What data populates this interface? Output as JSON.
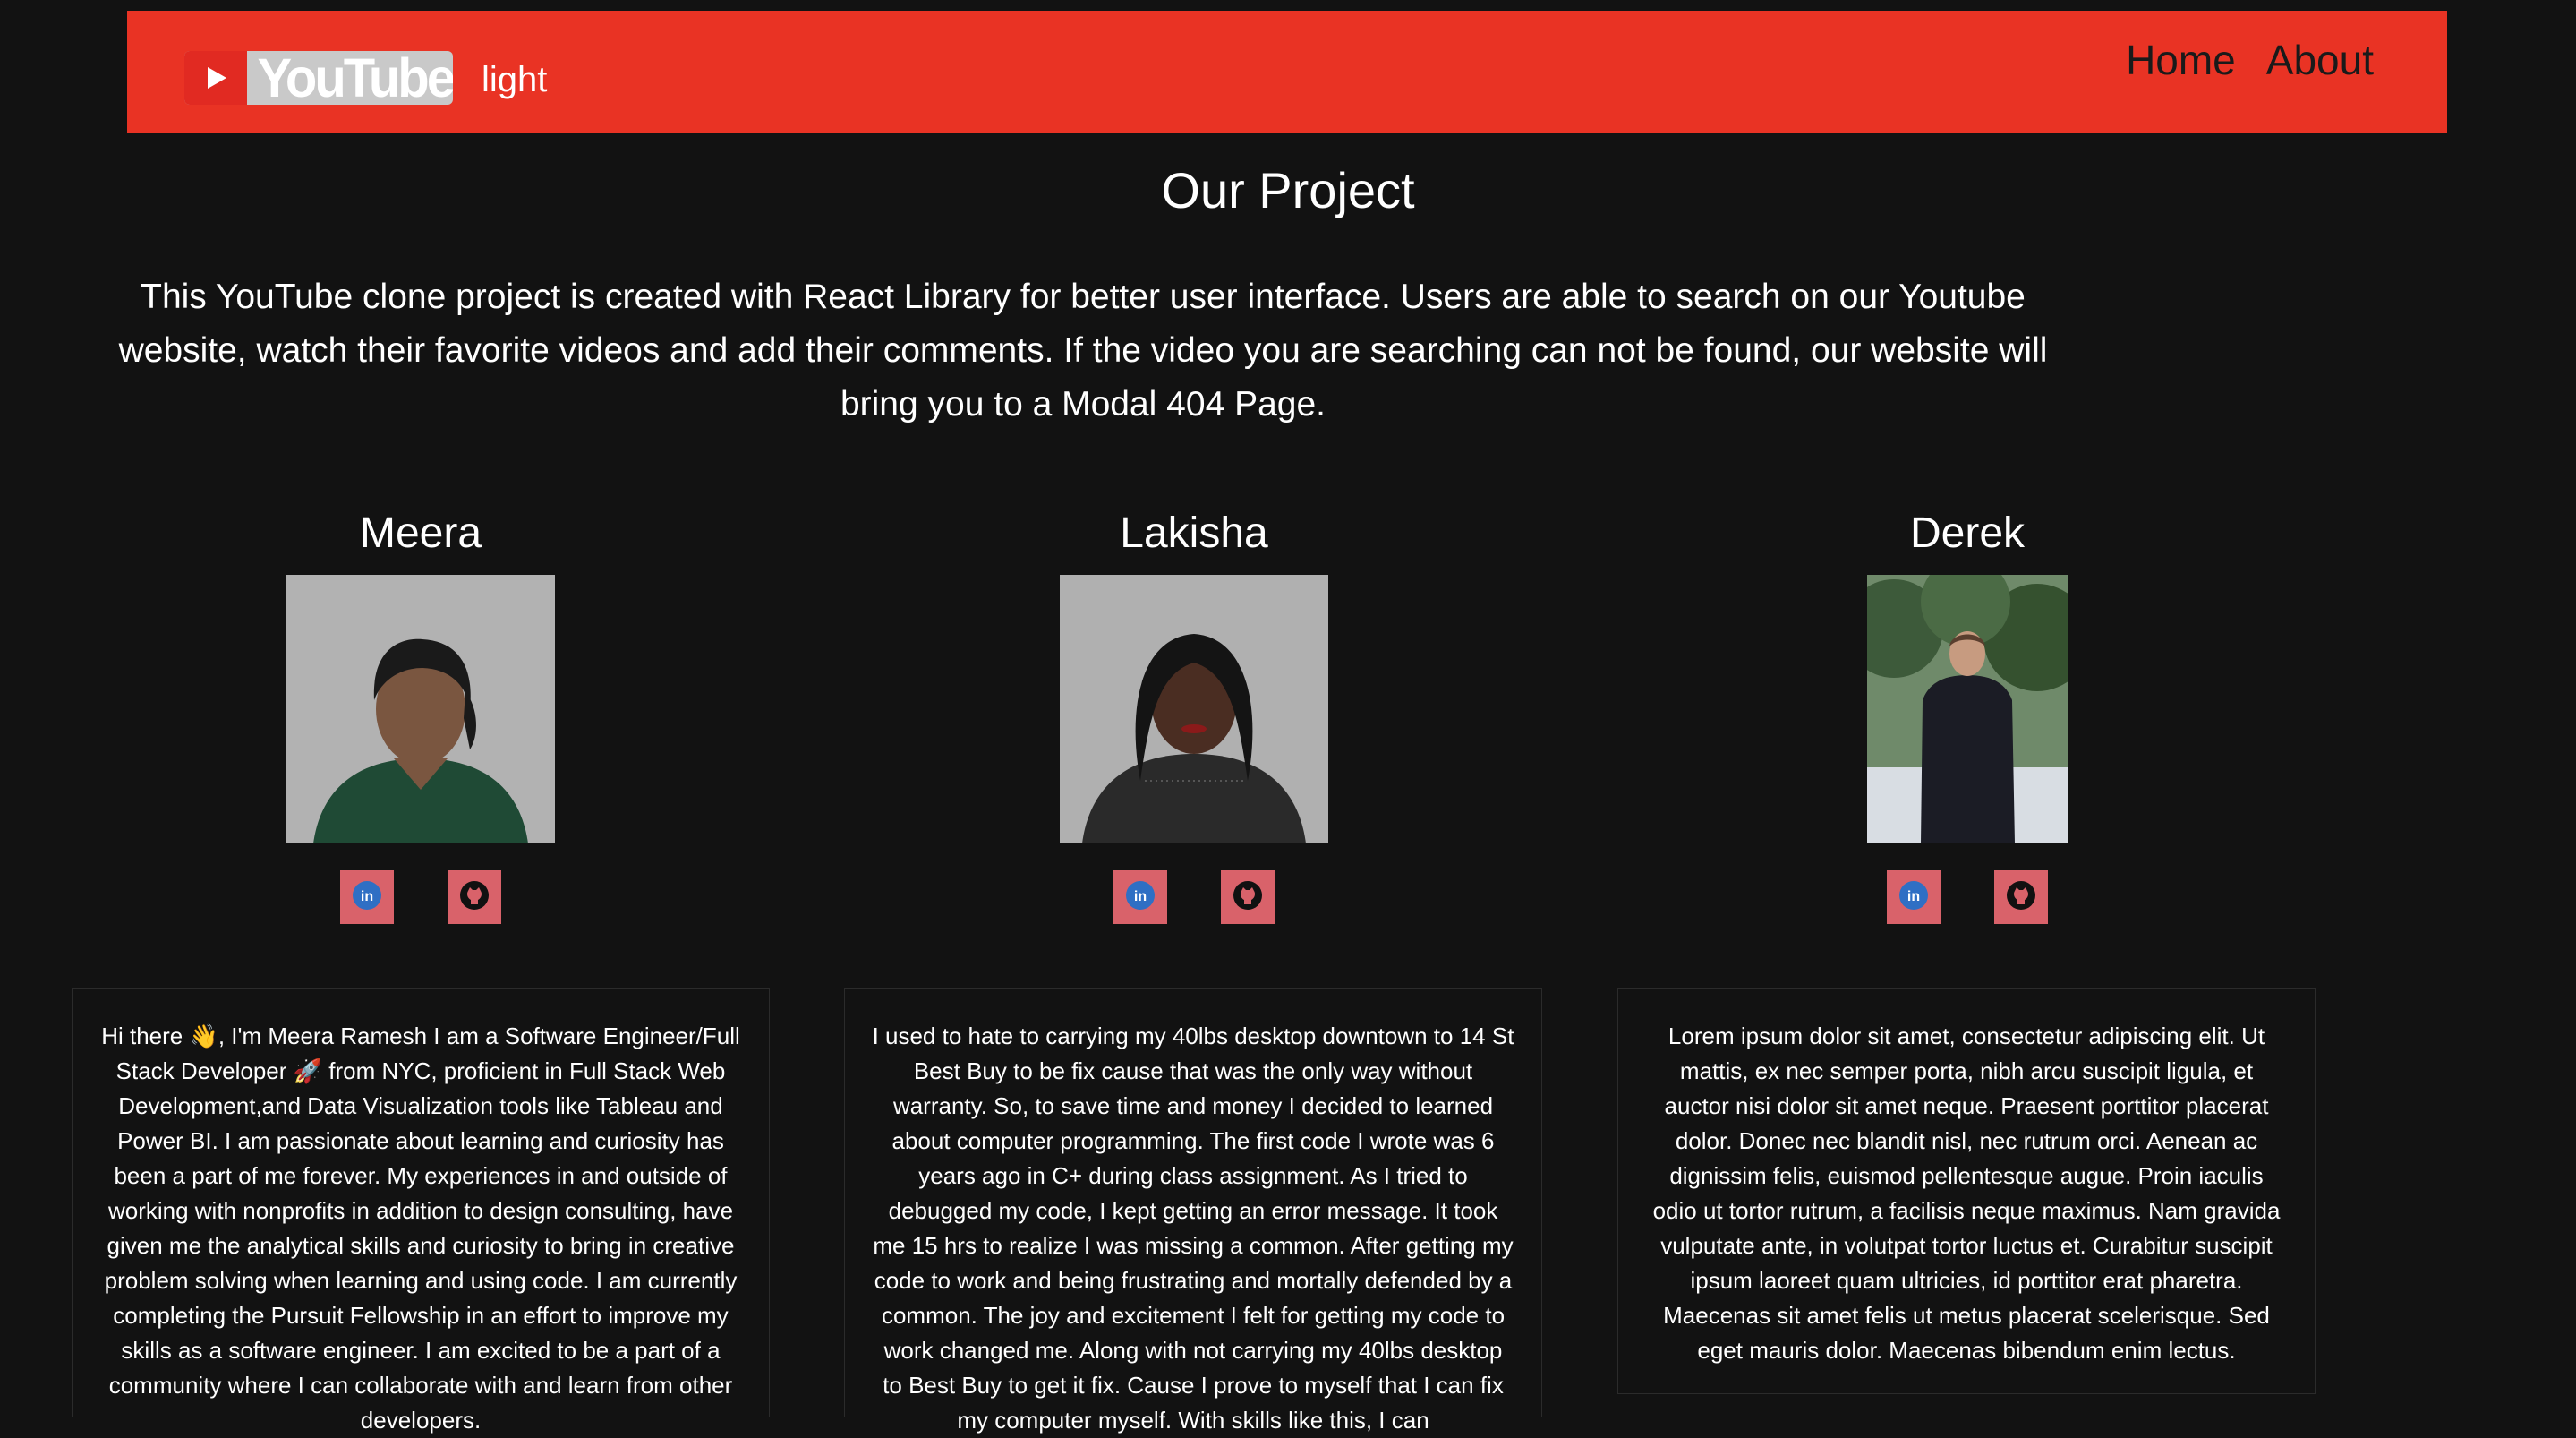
{
  "navbar": {
    "logo_text": "YouTube",
    "theme_label": "light",
    "links": [
      "Home",
      "About"
    ]
  },
  "page": {
    "title": "Our Project",
    "intro": "This YouTube clone project is created with React Library for better user interface. Users are able to search on our Youtube website, watch their favorite videos and add their comments. If the video you are searching can not be found, our website will bring you to a Modal 404 Page."
  },
  "members": [
    {
      "name": "Meera",
      "bio": "Hi there 👋, I'm Meera Ramesh I am a Software Engineer/Full Stack Developer 🚀 from NYC, proficient in Full Stack Web Development,and Data Visualization tools like Tableau and Power BI. I am passionate about learning and curiosity has been a part of me forever. My experiences in and outside of working with nonprofits in addition to design consulting, have given me the analytical skills and curiosity to bring in creative problem solving when learning and using code. I am currently completing the Pursuit Fellowship in an effort to improve my skills as a software engineer. I am excited to be a part of a community where I can collaborate with and learn from other developers."
    },
    {
      "name": "Lakisha",
      "bio": "I used to hate to carrying my 40lbs desktop downtown to 14 St Best Buy to be fix cause that was the only way without warranty. So, to save time and money I decided to learned about computer programming. The first code I wrote was 6 years ago in C+ during class assignment. As I tried to debugged my code, I kept getting an error message. It took me 15 hrs to realize I was missing a common. After getting my code to work and being frustrating and mortally defended by a common. The joy and excitement I felt for getting my code to work changed me. Along with not carrying my 40lbs desktop to Best Buy to get it fix. Cause I prove to myself that I can fix my computer myself. With skills like this, I can"
    },
    {
      "name": "Derek",
      "bio": "Lorem ipsum dolor sit amet, consectetur adipiscing elit. Ut mattis, ex nec semper porta, nibh arcu suscipit ligula, et auctor nisi dolor sit amet neque. Praesent porttitor placerat dolor. Donec nec blandit nisl, nec rutrum orci. Aenean ac dignissim felis, euismod pellentesque augue. Proin iaculis odio ut tortor rutrum, a facilisis neque maximus. Nam gravida vulputate ante, in volutpat tortor luctus et. Curabitur suscipit ipsum laoreet quam ultricies, id porttitor erat pharetra. Maecenas sit amet felis ut metus placerat scelerisque. Sed eget mauris dolor. Maecenas bibendum enim lectus."
    }
  ],
  "icons": {
    "linkedin": "linkedin-icon",
    "github": "github-icon"
  },
  "colors": {
    "navbar_bg": "#e93324",
    "page_bg": "#121212",
    "social_bg": "#d9626a",
    "linkedin_blue": "#2f6fc4"
  }
}
